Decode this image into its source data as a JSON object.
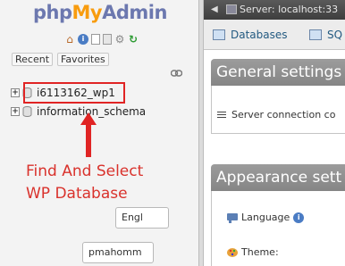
{
  "nav": {
    "logo": {
      "php": "php",
      "my": "My",
      "admin": "Admin"
    },
    "icons": [
      "home-icon",
      "info-icon",
      "documentation-icon",
      "page-icon",
      "settings-gear-icon",
      "reload-icon"
    ],
    "tabs": {
      "recent": "Recent",
      "favorites": "Favorites"
    },
    "databases": [
      {
        "name": "i6113162_wp1",
        "expander": "+",
        "highlighted": true
      },
      {
        "name": "information_schema",
        "expander": "+",
        "highlighted": false
      }
    ]
  },
  "annotation": {
    "line1": "Find And Select",
    "line2": "WP Database",
    "color": "#d9322c"
  },
  "right": {
    "topbar": {
      "server_label": "Server: localhost:33"
    },
    "tabs": {
      "databases": "Databases",
      "sql": "SQ"
    },
    "general_settings": {
      "title": "General settings",
      "server_connection_label": "Server connection co"
    },
    "appearance_settings": {
      "title": "Appearance sett",
      "language_label": "Language",
      "language_value": "Engl",
      "theme_label": "Theme:",
      "theme_value": "pmahomm"
    }
  },
  "colors": {
    "logo_blue": "#6c78af",
    "logo_orange": "#f89c0e",
    "highlight_red": "#e02424",
    "section_header_gray": "#8f8f8f"
  }
}
